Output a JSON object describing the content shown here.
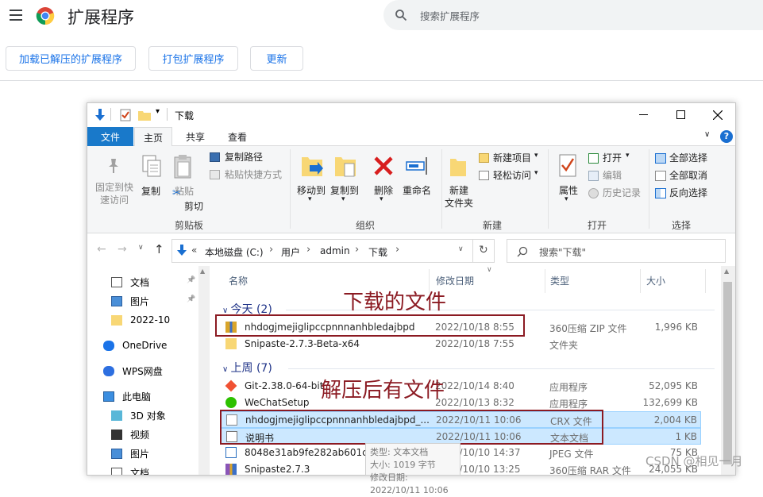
{
  "chrome": {
    "title": "扩展程序",
    "search_placeholder": "搜索扩展程序",
    "buttons": [
      "加载已解压的扩展程序",
      "打包扩展程序",
      "更新"
    ]
  },
  "explorer": {
    "window_title": "下载",
    "ribbon_tabs": [
      "文件",
      "主页",
      "共享",
      "查看"
    ],
    "ribbon": {
      "pin_label": "固定到快\n速访问",
      "copy_label": "复制",
      "paste_label": "粘贴",
      "copy_path": "复制路径",
      "paste_shortcut": "粘贴快捷方式",
      "cut": "剪切",
      "clipboard_group": "剪贴板",
      "move_to": "移动到",
      "copy_to": "复制到",
      "delete": "删除",
      "rename": "重命名",
      "organize_group": "组织",
      "new_folder": "新建\n文件夹",
      "new_item": "新建项目",
      "easy_access": "轻松访问",
      "new_group": "新建",
      "properties": "属性",
      "open": "打开",
      "edit": "编辑",
      "history": "历史记录",
      "open_group": "打开",
      "select_all": "全部选择",
      "select_none": "全部取消",
      "invert_selection": "反向选择",
      "select_group": "选择"
    },
    "address": {
      "root_chevron": "«",
      "crumbs": [
        "本地磁盘 (C:)",
        "用户",
        "admin",
        "下载"
      ],
      "sep": "›",
      "search_placeholder": "搜索\"下载\""
    },
    "nav_items": [
      {
        "label": "文档",
        "icon": "documents-icon"
      },
      {
        "label": "图片",
        "icon": "pictures-icon"
      },
      {
        "label": "2022-10",
        "icon": "folder-icon"
      },
      {
        "label": "OneDrive",
        "icon": "onedrive-icon"
      },
      {
        "label": "WPS网盘",
        "icon": "wps-cloud-icon"
      },
      {
        "label": "此电脑",
        "icon": "this-pc-icon"
      },
      {
        "label": "3D 对象",
        "icon": "3d-objects-icon"
      },
      {
        "label": "视频",
        "icon": "videos-icon"
      },
      {
        "label": "图片",
        "icon": "pictures-icon"
      },
      {
        "label": "文档",
        "icon": "documents-icon"
      }
    ],
    "columns": [
      "名称",
      "修改日期",
      "类型",
      "大小"
    ],
    "groups": [
      {
        "label": "今天 (2)",
        "rows": [
          {
            "name": "nhdogjmejiglipccpnnnanhbledajbpd",
            "date": "2022/10/18 8:55",
            "type": "360压缩 ZIP 文件",
            "size": "1,996 KB",
            "icon": "zip-archive-icon",
            "selected": false
          },
          {
            "name": "Snipaste-2.7.3-Beta-x64",
            "date": "2022/10/18 7:55",
            "type": "文件夹",
            "size": "",
            "icon": "folder-icon",
            "selected": false
          }
        ]
      },
      {
        "label": "上周 (7)",
        "rows": [
          {
            "name": "Git-2.38.0-64-bit",
            "date": "2022/10/14 8:40",
            "type": "应用程序",
            "size": "52,095 KB",
            "icon": "git-app-icon",
            "selected": false
          },
          {
            "name": "WeChatSetup",
            "date": "2022/10/13 8:32",
            "type": "应用程序",
            "size": "132,699 KB",
            "icon": "wechat-app-icon",
            "selected": false
          },
          {
            "name": "nhdogjmejiglipccpnnnanhbledajbpd_...",
            "date": "2022/10/11 10:06",
            "type": "CRX 文件",
            "size": "2,004 KB",
            "icon": "file-icon",
            "selected": true
          },
          {
            "name": "说明书",
            "date": "2022/10/11 10:06",
            "type": "文本文档",
            "size": "1 KB",
            "icon": "text-file-icon",
            "selected": true
          },
          {
            "name": "8048e31ab9fe282ab601c79f58c5e76e",
            "date": "2022/10/10 14:37",
            "type": "JPEG 文件",
            "size": "75 KB",
            "icon": "jpeg-file-icon",
            "selected": false
          },
          {
            "name": "Snipaste2.7.3",
            "date": "2022/10/10 13:25",
            "type": "360压缩 RAR 文件",
            "size": "24,055 KB",
            "icon": "rar-archive-icon",
            "selected": false
          }
        ]
      }
    ],
    "tooltip": [
      "类型: 文本文档",
      "大小: 1019 字节",
      "修改日期: 2022/10/11 10:06"
    ]
  },
  "annotations": {
    "downloaded": "下载的文件",
    "extracted": "解压后有文件"
  },
  "watermark": "CSDN @相见一月",
  "colors": {
    "accent": "#1a73e8",
    "annotation": "#8b1a22",
    "selection": "#cce8ff"
  }
}
